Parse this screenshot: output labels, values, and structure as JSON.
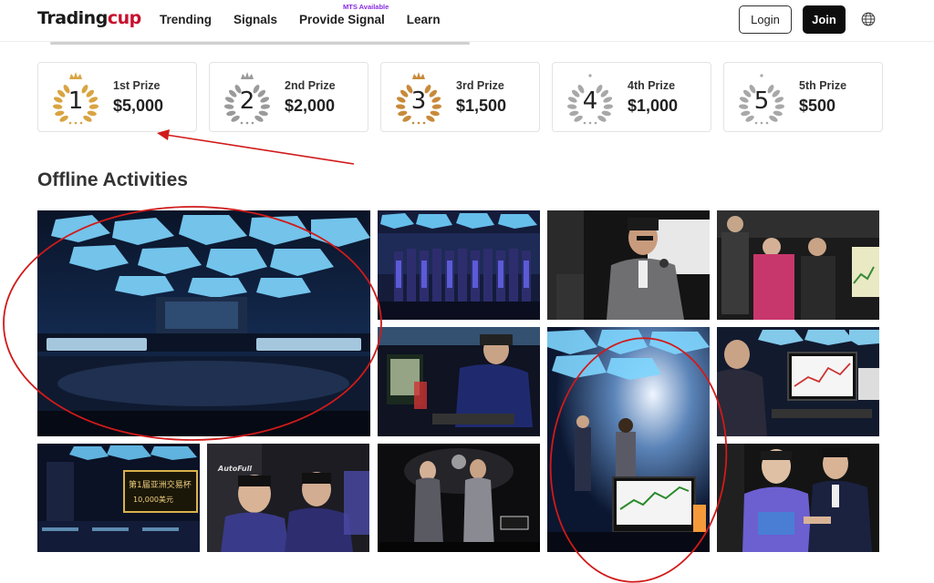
{
  "header": {
    "logo_main": "Trading",
    "logo_accent": "cup",
    "nav": [
      "Trending",
      "Signals",
      "Provide Signal",
      "Learn"
    ],
    "mts_badge": "MTS Available",
    "login_label": "Login",
    "join_label": "Join",
    "globe_icon": "globe-icon"
  },
  "prizes": [
    {
      "number": "1",
      "rank": "1st Prize",
      "amount": "$5,000",
      "tier": "gold"
    },
    {
      "number": "2",
      "rank": "2nd Prize",
      "amount": "$2,000",
      "tier": "silver"
    },
    {
      "number": "3",
      "rank": "3rd Prize",
      "amount": "$1,500",
      "tier": "bronze"
    },
    {
      "number": "4",
      "rank": "4th Prize",
      "amount": "$1,000",
      "tier": "plain"
    },
    {
      "number": "5",
      "rank": "5th Prize",
      "amount": "$500",
      "tier": "plain"
    }
  ],
  "colors": {
    "gold": "#d9a441",
    "silver": "#9a9a9a",
    "bronze": "#c88a3a",
    "plain": "#a8a8a8",
    "annotation": "#d11a1a"
  },
  "offline": {
    "title": "Offline Activities",
    "photos": [
      "arena-stage-photo",
      "team-lineup-photo",
      "speaker-photo",
      "audience-photo",
      "trader-screens-photo",
      "stage-presentation-photo",
      "chart-monitor-photo",
      "trading-hall-photo",
      "gamers-photo",
      "hosts-photo",
      "award-handshake-photo"
    ],
    "sign_text": "第1届亚洲交易杯",
    "sign_prize": "10,000美元",
    "monitor_brand": "AutoFull"
  }
}
